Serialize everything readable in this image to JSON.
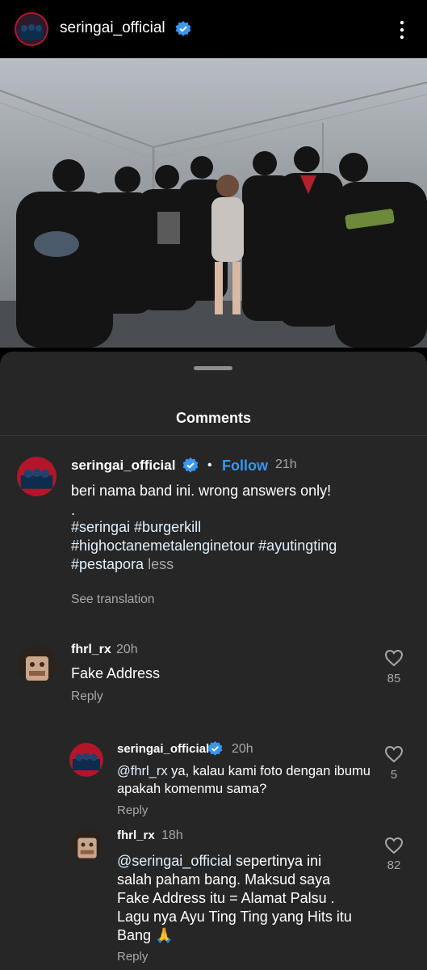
{
  "header": {
    "username": "seringai_official",
    "avatar_icon": "band-avatar-icon",
    "verified_icon": "verified-badge-icon",
    "more_icon": "more-vertical-icon"
  },
  "sheet": {
    "title": "Comments"
  },
  "caption": {
    "username": "seringai_official",
    "follow": "Follow",
    "bullet": "•",
    "time": "21h",
    "line1": "beri nama band ini. wrong answers only!",
    "line2": ".",
    "line3": "#seringai #burgerkill",
    "line4": "#highoctanemetalenginetour #ayutingting",
    "line5": "#pestapora",
    "less": "less",
    "see_translation": "See translation"
  },
  "comments": [
    {
      "username": "fhrl_rx",
      "time": "20h",
      "text": "Fake Address",
      "reply": "Reply",
      "likes": "85"
    }
  ],
  "replies": [
    {
      "username": "seringai_official",
      "time": "20h",
      "mention": "@fhrl_rx",
      "text_line1": " ya, kalau kami foto dengan ibumu",
      "text_line2": "apakah komenmu sama?",
      "reply": "Reply",
      "likes": "5"
    },
    {
      "username": "fhrl_rx",
      "time": "18h",
      "mention": "@seringai_official",
      "text_line1": " sepertinya ini",
      "text_line2": "salah paham bang. Maksud saya",
      "text_line3": "Fake Address itu = Alamat Palsu .",
      "text_line4": "Lagu nya Ayu Ting Ting yang Hits itu",
      "text_line5": "Bang 🙏",
      "reply": "Reply",
      "likes": "82"
    }
  ],
  "colors": {
    "link_blue": "#3797f0",
    "sheet_bg": "#262626",
    "muted": "#a8a8a8",
    "verified": "#3897f0"
  }
}
